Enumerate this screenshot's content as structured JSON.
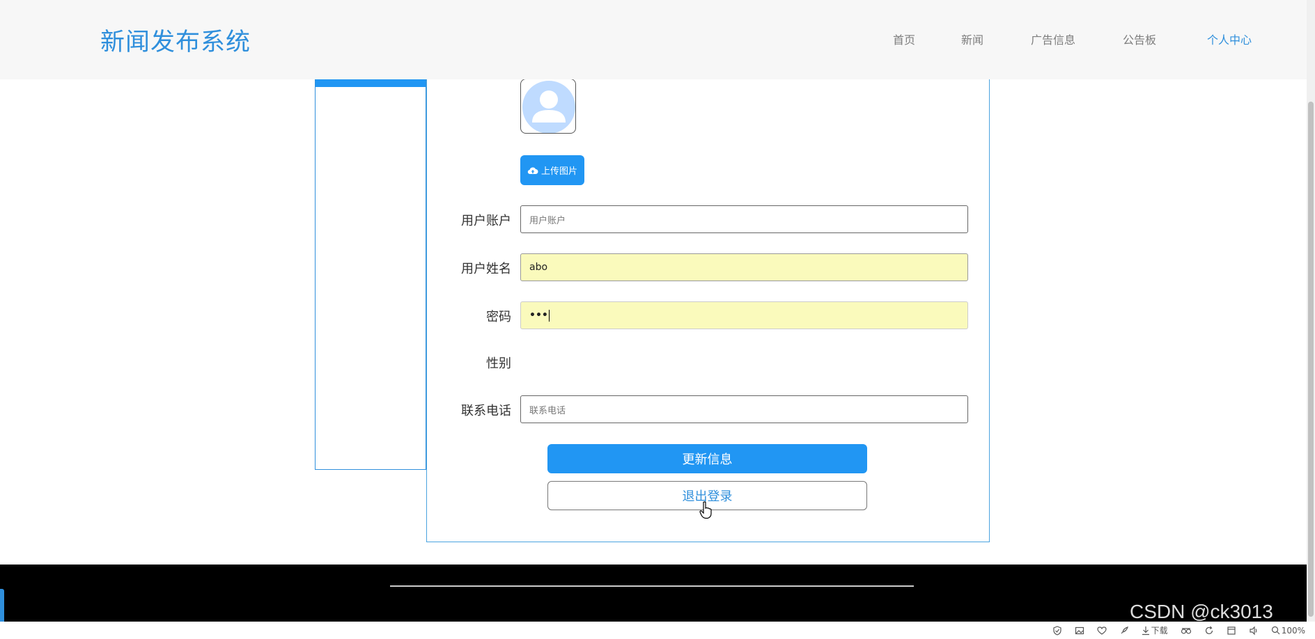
{
  "header": {
    "site_title": "新闻发布系统",
    "nav": [
      {
        "label": "首页"
      },
      {
        "label": "新闻"
      },
      {
        "label": "广告信息"
      },
      {
        "label": "公告板"
      },
      {
        "label": "个人中心",
        "active": true
      }
    ]
  },
  "form": {
    "upload_label": "上传图片",
    "fields": {
      "account": {
        "label": "用户账户",
        "placeholder": "用户账户",
        "value": ""
      },
      "name": {
        "label": "用户姓名",
        "value": "abo"
      },
      "password": {
        "label": "密码",
        "value": "•••"
      },
      "gender": {
        "label": "性别"
      },
      "phone": {
        "label": "联系电话",
        "placeholder": "联系电话",
        "value": ""
      }
    },
    "update_label": "更新信息",
    "logout_label": "退出登录"
  },
  "watermark": "CSDN @ck3013",
  "statusbar": {
    "download_label": "下载",
    "zoom": "100%"
  },
  "colors": {
    "accent": "#2196f3",
    "title": "#2f8fdc",
    "autofill": "#fafabc",
    "footer": "#000000"
  }
}
